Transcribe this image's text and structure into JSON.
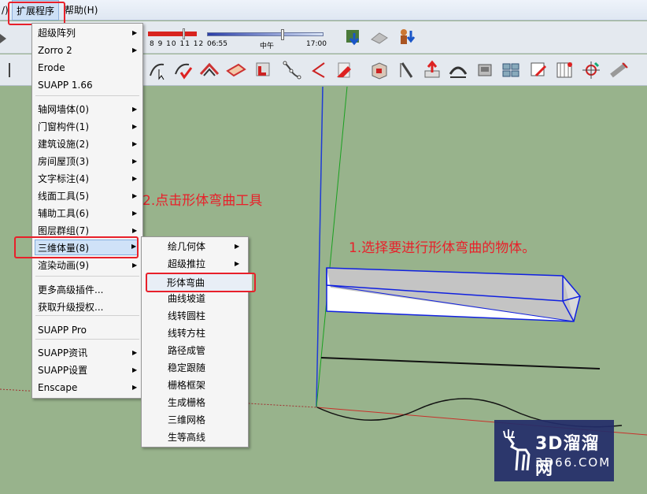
{
  "menubar": {
    "cut_item": "/)",
    "extensions": "扩展程序",
    "help": "帮助(H)"
  },
  "toolbar": {
    "month_numbers": "8  9  10 11 12",
    "time_start": "06:55",
    "time_mid": "中午",
    "time_end": "17:00"
  },
  "extensions_menu": {
    "items": [
      {
        "label": "超级阵列",
        "submenu": true
      },
      {
        "label": "Zorro 2",
        "submenu": true
      },
      {
        "label": "Erode",
        "submenu": false
      },
      {
        "label": "SUAPP 1.66",
        "submenu": false
      },
      {
        "label": "轴网墙体(0)",
        "submenu": true
      },
      {
        "label": "门窗构件(1)",
        "submenu": true
      },
      {
        "label": "建筑设施(2)",
        "submenu": true
      },
      {
        "label": "房间屋顶(3)",
        "submenu": true
      },
      {
        "label": "文字标注(4)",
        "submenu": true
      },
      {
        "label": "线面工具(5)",
        "submenu": true
      },
      {
        "label": "辅助工具(6)",
        "submenu": true
      },
      {
        "label": "图层群组(7)",
        "submenu": true
      },
      {
        "label": "三维体量(8)",
        "submenu": true
      },
      {
        "label": "渲染动画(9)",
        "submenu": true
      },
      {
        "label": "更多高级插件...",
        "submenu": false
      },
      {
        "label": "获取升级授权...",
        "submenu": false
      },
      {
        "label": "SUAPP Pro",
        "submenu": false
      },
      {
        "label": "SUAPP资讯",
        "submenu": true
      },
      {
        "label": "SUAPP设置",
        "submenu": true
      },
      {
        "label": "Enscape",
        "submenu": true
      }
    ]
  },
  "volume_submenu": {
    "items": [
      {
        "label": "绘几何体",
        "submenu": true
      },
      {
        "label": "超级推拉",
        "submenu": true
      },
      {
        "label": "形体弯曲",
        "submenu": false
      },
      {
        "label": "曲线坡道",
        "submenu": false
      },
      {
        "label": "线转圆柱",
        "submenu": false
      },
      {
        "label": "线转方柱",
        "submenu": false
      },
      {
        "label": "路径成管",
        "submenu": false
      },
      {
        "label": "稳定跟随",
        "submenu": false
      },
      {
        "label": "栅格框架",
        "submenu": false
      },
      {
        "label": "生成栅格",
        "submenu": false
      },
      {
        "label": "三维网格",
        "submenu": false
      },
      {
        "label": "生等高线",
        "submenu": false
      }
    ]
  },
  "annotations": {
    "step2": "2.点击形体弯曲工具",
    "step1": "1.选择要进行形体弯曲的物体。"
  },
  "watermark": {
    "title": "3D溜溜网",
    "subtitle": "3D66.COM"
  },
  "colors": {
    "canvas": "#98b38c",
    "highlight": "#e8202a",
    "selection_edges": "#1020e0"
  }
}
